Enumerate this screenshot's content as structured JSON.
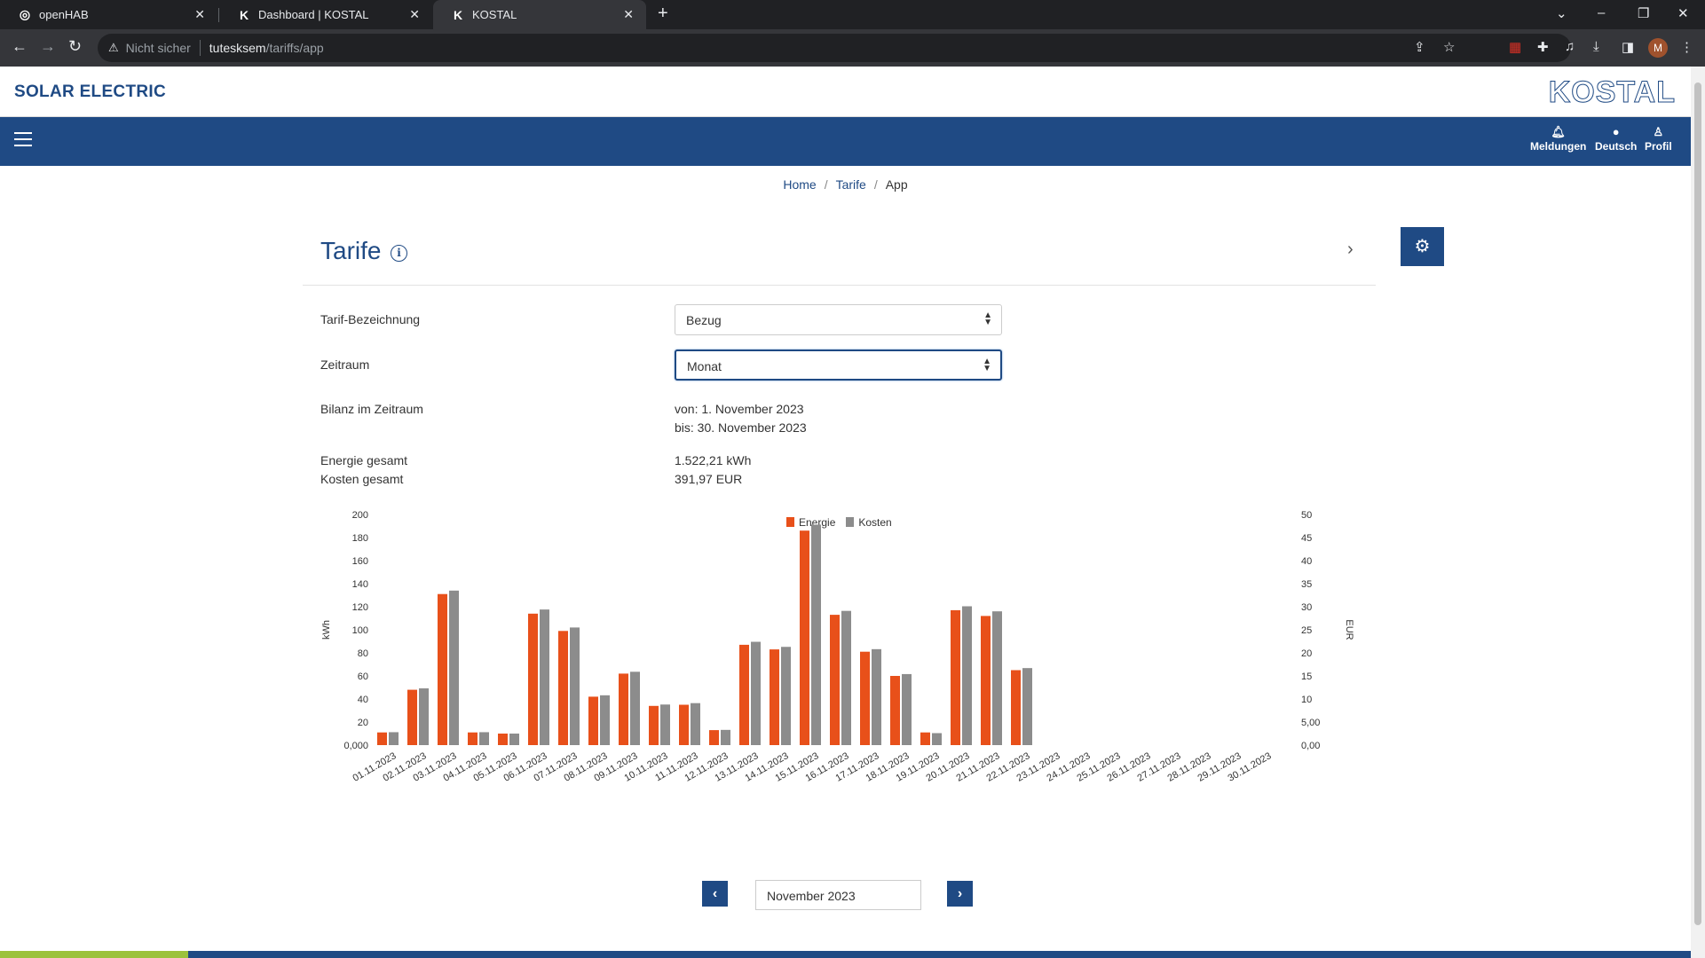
{
  "browser": {
    "tabs": [
      {
        "title": "openHAB",
        "favicon": "openhab-icon"
      },
      {
        "title": "Dashboard | KOSTAL",
        "favicon": "kostal-k-icon"
      },
      {
        "title": "KOSTAL",
        "favicon": "kostal-k-icon"
      }
    ],
    "new_tab_label": "+",
    "security_label": "Nicht sicher",
    "url_host": "tutesksem",
    "url_path": "/tariffs/app",
    "profile_initial": "M"
  },
  "site": {
    "brand": "SOLAR ELECTRIC",
    "logo_text": "KOSTAL",
    "nav": {
      "notifications": "Meldungen",
      "language": "Deutsch",
      "profile": "Profil"
    }
  },
  "breadcrumb": {
    "home": "Home",
    "tariffs": "Tarife",
    "current": "App"
  },
  "page": {
    "title": "Tarife",
    "info_glyph": "i",
    "tariff_label": "Tarif-Bezeichnung",
    "tariff_value": "Bezug",
    "period_label": "Zeitraum",
    "period_value": "Monat",
    "balance_label": "Bilanz im Zeitraum",
    "balance_from": "von: 1. November 2023",
    "balance_to": "bis: 30. November 2023",
    "energy_label": "Energie gesamt",
    "energy_value": "1.522,21 kWh",
    "cost_label": "Kosten gesamt",
    "cost_value": "391,97 EUR"
  },
  "pager": {
    "month": "November 2023",
    "prev_glyph": "‹",
    "next_glyph": "›"
  },
  "colors": {
    "brand_blue": "#1f4a84",
    "energy": "#e8501a",
    "cost": "#8c8c8c",
    "accent_green": "#9bc23c"
  },
  "chart_data": {
    "type": "bar",
    "categories": [
      "01.11.2023",
      "02.11.2023",
      "03.11.2023",
      "04.11.2023",
      "05.11.2023",
      "06.11.2023",
      "07.11.2023",
      "08.11.2023",
      "09.11.2023",
      "10.11.2023",
      "11.11.2023",
      "12.11.2023",
      "13.11.2023",
      "14.11.2023",
      "15.11.2023",
      "16.11.2023",
      "17.11.2023",
      "18.11.2023",
      "19.11.2023",
      "20.11.2023",
      "21.11.2023",
      "22.11.2023",
      "23.11.2023",
      "24.11.2023",
      "25.11.2023",
      "26.11.2023",
      "27.11.2023",
      "28.11.2023",
      "29.11.2023",
      "30.11.2023"
    ],
    "series": [
      {
        "name": "Energie",
        "axis": "left",
        "values": [
          11,
          48,
          131,
          11,
          10,
          114,
          99,
          42,
          62,
          34,
          35,
          13,
          87,
          83,
          186,
          113,
          81,
          60,
          11,
          117,
          112,
          65,
          0,
          0,
          0,
          0,
          0,
          0,
          0,
          0
        ]
      },
      {
        "name": "Kosten",
        "axis": "right",
        "values": [
          2.8,
          12.3,
          33.5,
          2.8,
          2.5,
          29.4,
          25.5,
          10.8,
          15.9,
          8.8,
          9.1,
          3.3,
          22.4,
          21.3,
          47.8,
          29.1,
          20.8,
          15.4,
          2.6,
          30.1,
          29.0,
          16.7,
          0,
          0,
          0,
          0,
          0,
          0,
          0,
          0
        ]
      }
    ],
    "ylabel": "kWh",
    "y2label": "EUR",
    "ylim": [
      0,
      200
    ],
    "y2lim": [
      0,
      50
    ],
    "yticks": [
      "0,000",
      "20",
      "40",
      "60",
      "80",
      "100",
      "120",
      "140",
      "160",
      "180",
      "200"
    ],
    "y2ticks": [
      "0,00",
      "5,00",
      "10",
      "15",
      "20",
      "25",
      "30",
      "35",
      "40",
      "45",
      "50"
    ],
    "legend_position": "top-center",
    "grid": false
  }
}
